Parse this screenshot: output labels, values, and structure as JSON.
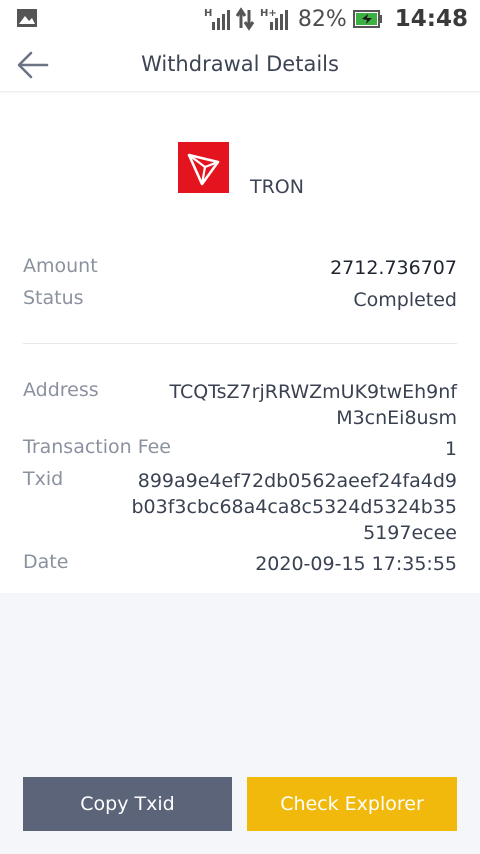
{
  "status_bar": {
    "battery": "82%",
    "time": "14:48"
  },
  "header": {
    "title": "Withdrawal Details"
  },
  "coin": {
    "name": "TRON",
    "logo_color": "#e3141d"
  },
  "details": {
    "amount": {
      "label": "Amount",
      "value": "2712.736707"
    },
    "status": {
      "label": "Status",
      "value": "Completed"
    },
    "address": {
      "label": "Address",
      "line1": "TCQTsZ7rjRRWZmUK9twEh9nf",
      "line2": "M3cnEi8usm"
    },
    "fee": {
      "label": "Transaction Fee",
      "value": "1"
    },
    "txid": {
      "label": "Txid",
      "line1": "899a9e4ef72db0562aeef24fa4d9",
      "line2": "b03f3cbc68a4ca8c5324d5324b35",
      "line3": "5197ecee"
    },
    "date": {
      "label": "Date",
      "value": "2020-09-15 17:35:55"
    }
  },
  "buttons": {
    "copy_label": "Copy Txid",
    "explorer_label": "Check Explorer"
  },
  "colors": {
    "accent": "#f0b90b",
    "secondary_button": "#5b6478"
  }
}
